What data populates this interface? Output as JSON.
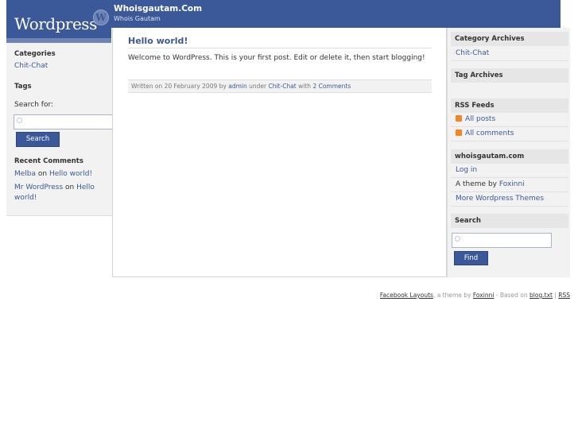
{
  "header": {
    "logo_text": "Wordpress",
    "logo_mark": "W",
    "site_title": "Whoisgautam.Com",
    "site_tagline": "Whois Gautam"
  },
  "left_sidebar": {
    "categories_heading": "Categories",
    "categories_item": "Chit-Chat",
    "tags_heading": "Tags",
    "search_label": "Search for:",
    "search_value": "",
    "search_button": "Search",
    "recent_comments_heading": "Recent Comments",
    "comment1_author": "Melba",
    "comment1_on": "on",
    "comment1_post": "Hello world!",
    "comment2_author": "Mr WordPress",
    "comment2_on": "on",
    "comment2_post_line1": "Hello",
    "comment2_post_line2": "world!"
  },
  "post": {
    "title": "Hello world!",
    "body": "Welcome to WordPress. This is your first post. Edit or delete it, then start blogging!",
    "meta_written": "Written on 20 February 2009",
    "meta_by": "by",
    "meta_author": "admin",
    "meta_under": "under",
    "meta_category": "Chit-Chat",
    "meta_with": "with",
    "meta_comments": "2 Comments"
  },
  "right_sidebar": {
    "category_archives_heading": "Category Archives",
    "category_archives_item": "Chit-Chat",
    "tag_archives_heading": "Tag Archives",
    "rss_heading": "RSS Feeds",
    "rss_all_posts": "All posts",
    "rss_all_comments": "All comments",
    "site_heading": "whoisgautam.com",
    "login": "Log in",
    "theme_by_prefix": "A theme by",
    "theme_author": "Foxinni",
    "more_themes": "More Wordpress Themes",
    "search_heading": "Search",
    "search_value": "",
    "find_button": "Find"
  },
  "footer": {
    "layouts_link": "Facebook Layouts",
    "theme_by": ", a theme by",
    "author_link": "Foxinni",
    "based_on": "- Based on",
    "blogtxt_link": "blog.txt",
    "separator": "|",
    "rss_link": "RSS"
  }
}
